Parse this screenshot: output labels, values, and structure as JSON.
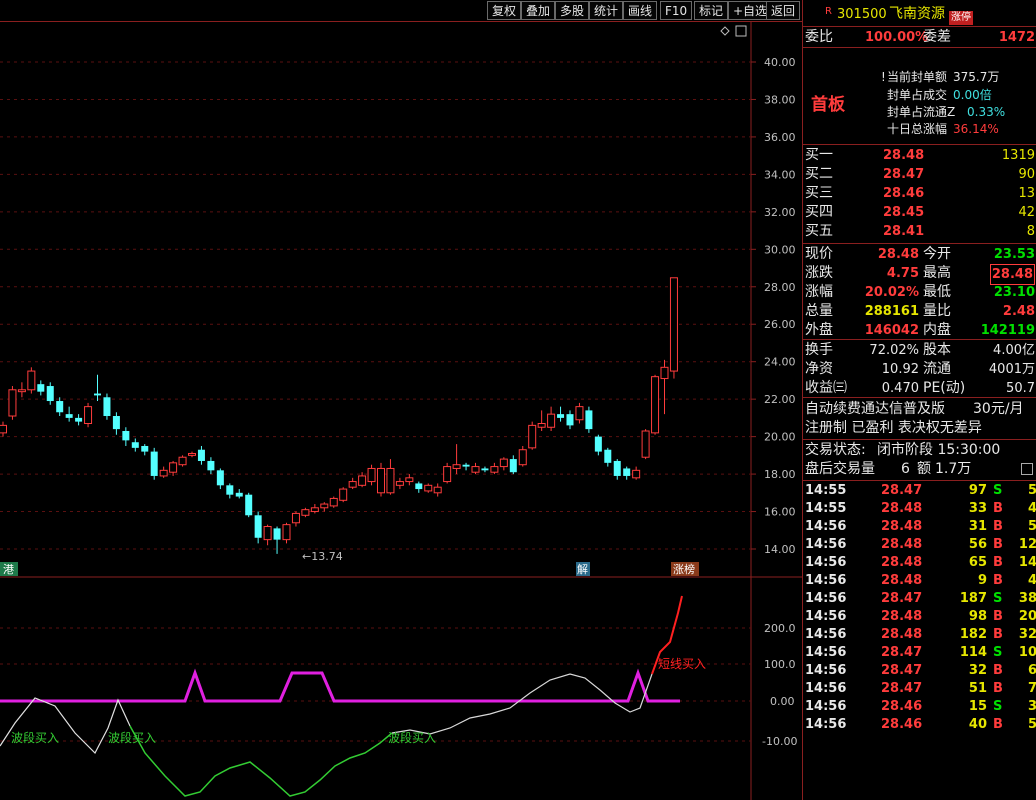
{
  "toolbar": {
    "buttons": [
      "复权",
      "叠加",
      "多股",
      "统计",
      "画线",
      "F10",
      "标记",
      "+自选",
      "返回"
    ]
  },
  "main_axis": {
    "ticks": [
      "40.00",
      "38.00",
      "36.00",
      "34.00",
      "32.00",
      "30.00",
      "28.00",
      "26.00",
      "24.00",
      "22.00",
      "20.00",
      "18.00",
      "16.00",
      "14.00"
    ],
    "min_label": "←13.74",
    "markers": {
      "left": "港",
      "mid": "解",
      "right": "涨榜"
    }
  },
  "indicator": {
    "ticks": [
      "200.0",
      "100.0",
      "0.00",
      "-10.00"
    ],
    "signals": [
      "波段买入",
      "波段买入",
      "波段买入",
      "短线买入"
    ]
  },
  "quote": {
    "r_badge": "R",
    "code": "301500",
    "name": "飞南资源",
    "limit_badge": "涨停",
    "weibi_label": "委比",
    "weibi_value": "100.00%",
    "weicha_label": "委差",
    "weicha_value": "1472",
    "board_label": "首板",
    "seal_amount_label": "当前封单额",
    "seal_amount_value": "375.7万",
    "seal_trade_label": "封单占成交",
    "seal_trade_value": "0.00倍",
    "seal_float_label": "封单占流通Z",
    "seal_float_value": "0.33%",
    "tenday_label": "十日总涨幅",
    "tenday_value": "36.14%",
    "bids": [
      {
        "label": "买一",
        "price": "28.48",
        "vol": "1319"
      },
      {
        "label": "买二",
        "price": "28.47",
        "vol": "90"
      },
      {
        "label": "买三",
        "price": "28.46",
        "vol": "13"
      },
      {
        "label": "买四",
        "price": "28.45",
        "vol": "42"
      },
      {
        "label": "买五",
        "price": "28.41",
        "vol": "8"
      }
    ],
    "stats": [
      {
        "l1": "现价",
        "v1": "28.48",
        "l2": "今开",
        "v2": "23.53"
      },
      {
        "l1": "涨跌",
        "v1": "4.75",
        "l2": "最高",
        "v2": "28.48"
      },
      {
        "l1": "涨幅",
        "v1": "20.02%",
        "l2": "最低",
        "v2": "23.10"
      },
      {
        "l1": "总量",
        "v1": "288161",
        "l2": "量比",
        "v2": "2.48"
      },
      {
        "l1": "外盘",
        "v1": "146042",
        "l2": "内盘",
        "v2": "142119"
      }
    ],
    "stats2": [
      {
        "l1": "换手",
        "v1": "72.02%",
        "l2": "股本",
        "v2": "4.00亿"
      },
      {
        "l1": "净资",
        "v1": "10.92",
        "l2": "流通",
        "v2": "4001万"
      },
      {
        "l1": "收益㈢",
        "v1": "0.470",
        "l2": "PE(动)",
        "v2": "50.7"
      }
    ],
    "promo1": "自动续费通达信普及版",
    "promo1_price": "30元/月",
    "promo2": "注册制 已盈利 表决权无差异",
    "status_label": "交易状态:",
    "status_value": "闭市阶段 15:30:00",
    "after_label": "盘后交易量",
    "after_vol": "6",
    "after_amt_label": "额",
    "after_amt": "1.7万",
    "ticks": [
      {
        "t": "14:55",
        "p": "28.47",
        "v": "97",
        "s": "S",
        "n": "5"
      },
      {
        "t": "14:55",
        "p": "28.48",
        "v": "33",
        "s": "B",
        "n": "4"
      },
      {
        "t": "14:56",
        "p": "28.48",
        "v": "31",
        "s": "B",
        "n": "5"
      },
      {
        "t": "14:56",
        "p": "28.48",
        "v": "56",
        "s": "B",
        "n": "12"
      },
      {
        "t": "14:56",
        "p": "28.48",
        "v": "65",
        "s": "B",
        "n": "14"
      },
      {
        "t": "14:56",
        "p": "28.48",
        "v": "9",
        "s": "B",
        "n": "4"
      },
      {
        "t": "14:56",
        "p": "28.47",
        "v": "187",
        "s": "S",
        "n": "38"
      },
      {
        "t": "14:56",
        "p": "28.48",
        "v": "98",
        "s": "B",
        "n": "20"
      },
      {
        "t": "14:56",
        "p": "28.48",
        "v": "182",
        "s": "B",
        "n": "32"
      },
      {
        "t": "14:56",
        "p": "28.47",
        "v": "114",
        "s": "S",
        "n": "10"
      },
      {
        "t": "14:56",
        "p": "28.47",
        "v": "32",
        "s": "B",
        "n": "6"
      },
      {
        "t": "14:56",
        "p": "28.47",
        "v": "51",
        "s": "B",
        "n": "7"
      },
      {
        "t": "14:56",
        "p": "28.46",
        "v": "15",
        "s": "S",
        "n": "3"
      },
      {
        "t": "14:56",
        "p": "28.46",
        "v": "40",
        "s": "B",
        "n": "5"
      }
    ]
  },
  "colors": {
    "up": "#ff3c3c",
    "down": "#54ffff",
    "grid_red": "#8a1f1f",
    "magenta": "#e020e0",
    "green": "#33cc33"
  },
  "candles": [
    [
      20.2,
      20.6,
      20.0,
      20.8
    ],
    [
      21.1,
      22.5,
      20.9,
      22.7
    ],
    [
      22.4,
      22.5,
      22.1,
      22.9
    ],
    [
      22.5,
      23.5,
      22.3,
      23.7
    ],
    [
      22.8,
      22.4,
      22.2,
      23.0
    ],
    [
      22.7,
      21.9,
      21.7,
      22.9
    ],
    [
      21.9,
      21.3,
      21.1,
      22.1
    ],
    [
      21.2,
      21.0,
      20.8,
      21.6
    ],
    [
      21.0,
      20.8,
      20.6,
      21.2
    ],
    [
      20.7,
      21.6,
      20.5,
      21.8
    ],
    [
      22.3,
      22.2,
      21.9,
      23.3
    ],
    [
      22.1,
      21.1,
      20.9,
      22.3
    ],
    [
      21.1,
      20.4,
      20.1,
      21.3
    ],
    [
      20.3,
      19.8,
      19.5,
      20.5
    ],
    [
      19.7,
      19.4,
      19.2,
      19.9
    ],
    [
      19.5,
      19.2,
      19.0,
      19.6
    ],
    [
      19.2,
      17.9,
      17.7,
      19.4
    ],
    [
      17.9,
      18.2,
      17.8,
      18.4
    ],
    [
      18.1,
      18.6,
      17.9,
      18.7
    ],
    [
      18.5,
      18.9,
      18.4,
      19.0
    ],
    [
      19.0,
      19.1,
      18.9,
      19.2
    ],
    [
      19.3,
      18.7,
      18.5,
      19.5
    ],
    [
      18.7,
      18.2,
      18.0,
      18.9
    ],
    [
      18.2,
      17.4,
      17.2,
      18.3
    ],
    [
      17.4,
      16.9,
      16.7,
      17.5
    ],
    [
      17.0,
      16.8,
      16.7,
      17.2
    ],
    [
      16.9,
      15.8,
      15.7,
      17.0
    ],
    [
      15.8,
      14.6,
      14.3,
      16.0
    ],
    [
      14.5,
      15.2,
      14.2,
      15.3
    ],
    [
      15.1,
      14.5,
      13.74,
      15.2
    ],
    [
      14.5,
      15.3,
      14.3,
      15.4
    ],
    [
      15.4,
      15.9,
      15.2,
      16.0
    ],
    [
      15.8,
      16.1,
      15.7,
      16.2
    ],
    [
      16.0,
      16.2,
      15.9,
      16.4
    ],
    [
      16.2,
      16.4,
      16.0,
      16.5
    ],
    [
      16.3,
      16.7,
      16.2,
      16.8
    ],
    [
      16.6,
      17.2,
      16.5,
      17.3
    ],
    [
      17.3,
      17.6,
      17.2,
      17.8
    ],
    [
      17.4,
      17.9,
      17.3,
      18.1
    ],
    [
      17.6,
      18.3,
      17.4,
      18.5
    ],
    [
      17.0,
      18.3,
      16.8,
      18.6
    ],
    [
      17.0,
      18.3,
      16.9,
      18.8
    ],
    [
      17.4,
      17.6,
      17.2,
      17.8
    ],
    [
      17.6,
      17.8,
      17.4,
      18.0
    ],
    [
      17.5,
      17.2,
      17.0,
      17.6
    ],
    [
      17.1,
      17.4,
      17.0,
      17.5
    ],
    [
      17.0,
      17.3,
      16.8,
      17.5
    ],
    [
      17.6,
      18.4,
      17.5,
      18.6
    ],
    [
      18.3,
      18.5,
      18.0,
      19.6
    ],
    [
      18.5,
      18.4,
      18.2,
      18.6
    ],
    [
      18.1,
      18.4,
      18.0,
      18.6
    ],
    [
      18.3,
      18.2,
      18.1,
      18.4
    ],
    [
      18.1,
      18.4,
      18.0,
      18.6
    ],
    [
      18.4,
      18.8,
      18.2,
      18.9
    ],
    [
      18.8,
      18.1,
      18.0,
      19.0
    ],
    [
      18.5,
      19.3,
      18.4,
      19.5
    ],
    [
      19.4,
      20.6,
      19.3,
      20.8
    ],
    [
      20.5,
      20.7,
      20.3,
      21.4
    ],
    [
      20.5,
      21.2,
      20.3,
      21.6
    ],
    [
      21.2,
      21.0,
      20.8,
      21.6
    ],
    [
      21.2,
      20.6,
      20.4,
      21.4
    ],
    [
      20.9,
      21.6,
      20.7,
      21.8
    ],
    [
      21.4,
      20.4,
      20.2,
      21.6
    ],
    [
      20.0,
      19.2,
      19.0,
      20.1
    ],
    [
      19.3,
      18.6,
      18.4,
      19.4
    ],
    [
      18.7,
      17.9,
      17.7,
      18.8
    ],
    [
      18.3,
      17.9,
      17.7,
      18.4
    ],
    [
      17.8,
      18.2,
      17.7,
      18.4
    ],
    [
      18.9,
      20.3,
      18.8,
      20.4
    ],
    [
      20.2,
      23.2,
      20.1,
      23.3
    ],
    [
      23.1,
      23.7,
      21.2,
      24.1
    ],
    [
      23.5,
      28.48,
      23.1,
      28.48
    ]
  ]
}
